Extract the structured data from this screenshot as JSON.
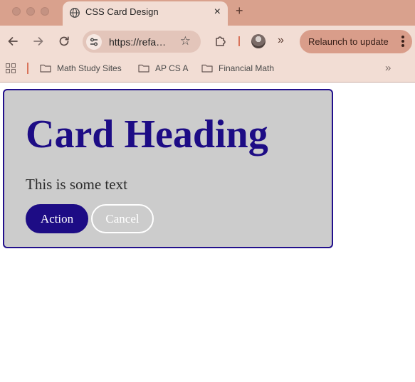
{
  "browser": {
    "tab": {
      "title": "CSS Card Design",
      "close_glyph": "×",
      "icon": "globe-icon"
    },
    "new_tab_glyph": "+",
    "toolbar": {
      "url": "https://refa…",
      "star_glyph": "☆",
      "more_extensions_glyph": "»",
      "relaunch_label": "Relaunch to update"
    },
    "bookmarks": {
      "items": [
        {
          "label": "Math Study Sites",
          "icon": "folder-icon"
        },
        {
          "label": "AP CS A",
          "icon": "folder-icon"
        },
        {
          "label": "Financial Math",
          "icon": "folder-icon"
        }
      ],
      "more_glyph": "»"
    },
    "colors": {
      "frame": "#d9a18d",
      "toolbar": "#f2ddd4",
      "accent": "#d99d8a"
    }
  },
  "page": {
    "card": {
      "heading": "Card Heading",
      "text": "This is some text",
      "action_label": "Action",
      "cancel_label": "Cancel"
    },
    "colors": {
      "card_bg": "#cccccc",
      "primary": "#1d0c85",
      "cancel_border": "#ffffff"
    }
  }
}
